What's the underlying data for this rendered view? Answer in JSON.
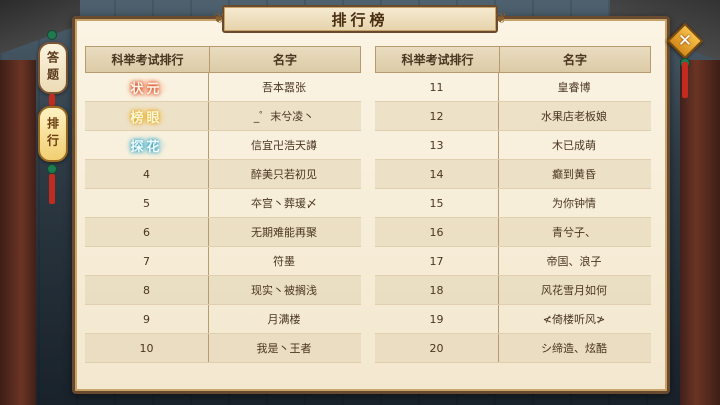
{
  "title": "排行榜",
  "tabs": [
    {
      "label": "答题",
      "active": false
    },
    {
      "label": "排行",
      "active": true
    }
  ],
  "close_icon": "close-x-icon",
  "headers": {
    "rank": "科举考试排行",
    "name": "名字"
  },
  "left_rows": [
    {
      "rank": "状元",
      "name": "吾本嚣张",
      "badge": "b1"
    },
    {
      "rank": "榜眼",
      "name": "_゜末兮凌丶",
      "badge": "b2"
    },
    {
      "rank": "探花",
      "name": "信宜卍浩天譐",
      "badge": "b3"
    },
    {
      "rank": "4",
      "name": "醉美只若初见"
    },
    {
      "rank": "5",
      "name": "夲宫丶葬瑗〆"
    },
    {
      "rank": "6",
      "name": "无期难能再聚"
    },
    {
      "rank": "7",
      "name": "符墨"
    },
    {
      "rank": "8",
      "name": "现实丶被搁浅"
    },
    {
      "rank": "9",
      "name": "月满楼"
    },
    {
      "rank": "10",
      "name": "我是丶王者"
    }
  ],
  "right_rows": [
    {
      "rank": "11",
      "name": "皇睿博"
    },
    {
      "rank": "12",
      "name": "水果店老板娘"
    },
    {
      "rank": "13",
      "name": "木已成萌"
    },
    {
      "rank": "14",
      "name": "癫到黄昏"
    },
    {
      "rank": "15",
      "name": "为你钟情"
    },
    {
      "rank": "16",
      "name": "青兮子、"
    },
    {
      "rank": "17",
      "name": "帝国、浪子"
    },
    {
      "rank": "18",
      "name": "风花雪月如何"
    },
    {
      "rank": "19",
      "name": "≮倚楼听风≯"
    },
    {
      "rank": "20",
      "name": "シ缔造、炫酷"
    }
  ]
}
